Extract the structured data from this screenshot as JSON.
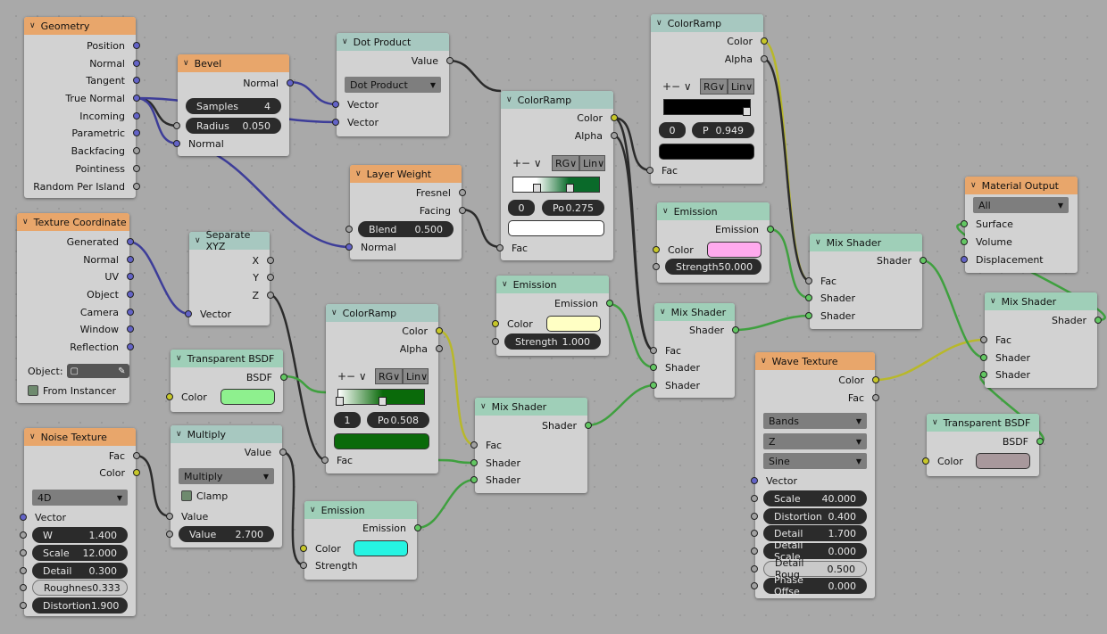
{
  "geometry": {
    "title": "Geometry",
    "outputs": [
      "Position",
      "Normal",
      "Tangent",
      "True Normal",
      "Incoming",
      "Parametric",
      "Backfacing",
      "Pointiness",
      "Random Per Island"
    ]
  },
  "texcoord": {
    "title": "Texture Coordinate",
    "outputs": [
      "Generated",
      "Normal",
      "UV",
      "Object",
      "Camera",
      "Window",
      "Reflection"
    ],
    "object_label": "Object:",
    "from_instancer": "From Instancer"
  },
  "noise": {
    "title": "Noise Texture",
    "outputs": [
      "Fac",
      "Color"
    ],
    "dimension": "4D",
    "vector": "Vector",
    "fields": [
      {
        "label": "W",
        "value": "1.400"
      },
      {
        "label": "Scale",
        "value": "12.000"
      },
      {
        "label": "Detail",
        "value": "0.300"
      },
      {
        "label": "Roughnes",
        "value": "0.333"
      },
      {
        "label": "Distortion",
        "value": "1.900"
      }
    ]
  },
  "bevel": {
    "title": "Bevel",
    "output": "Normal",
    "samples_label": "Samples",
    "samples_value": "4",
    "radius_label": "Radius",
    "radius_value": "0.050",
    "normal": "Normal"
  },
  "separate": {
    "title": "Separate XYZ",
    "outputs": [
      "X",
      "Y",
      "Z"
    ],
    "input": "Vector"
  },
  "transparent1": {
    "title": "Transparent BSDF",
    "output": "BSDF",
    "color_label": "Color",
    "color": "#8ef08e"
  },
  "multiply": {
    "title": "Multiply",
    "output": "Value",
    "operation": "Multiply",
    "clamp": "Clamp",
    "input": "Value",
    "value_label": "Value",
    "value": "2.700"
  },
  "dot": {
    "title": "Dot Product",
    "output": "Value",
    "operation": "Dot Product",
    "inputs": [
      "Vector",
      "Vector"
    ]
  },
  "layerweight": {
    "title": "Layer Weight",
    "outputs": [
      "Fresnel",
      "Facing"
    ],
    "blend_label": "Blend",
    "blend_value": "0.500",
    "normal": "Normal"
  },
  "colorramp1": {
    "title": "ColorRamp",
    "outputs": [
      "Color",
      "Alpha"
    ],
    "tools": "+− ∨",
    "mode": "RG∨",
    "interp": "Lin∨",
    "index": "0",
    "pos_label": "Po",
    "pos": "0.275",
    "fac": "Fac",
    "swatch": "#ffffff"
  },
  "colorramp2": {
    "title": "ColorRamp",
    "outputs": [
      "Color",
      "Alpha"
    ],
    "tools": "+− ∨",
    "mode": "RG∨",
    "interp": "Lin∨",
    "index": "1",
    "pos_label": "Po",
    "pos": "0.508",
    "fac": "Fac",
    "swatch": "#0a6a0a"
  },
  "colorramp3": {
    "title": "ColorRamp",
    "outputs": [
      "Color",
      "Alpha"
    ],
    "tools": "+− ∨",
    "mode": "RG∨",
    "interp": "Lin∨",
    "index": "0",
    "pos_label": "P",
    "pos": "0.949",
    "fac": "Fac",
    "swatch": "#000000"
  },
  "emission1": {
    "title": "Emission",
    "output": "Emission",
    "color_label": "Color",
    "color": "#ffffc4",
    "strength_label": "Strength",
    "strength": "1.000"
  },
  "emission2": {
    "title": "Emission",
    "output": "Emission",
    "color_label": "Color",
    "color": "#26f4e2",
    "strength_label": "Strength"
  },
  "emission3": {
    "title": "Emission",
    "output": "Emission",
    "color_label": "Color",
    "color": "#ffaaee",
    "strength_label": "Strength",
    "strength": "50.000"
  },
  "mix1": {
    "title": "Mix Shader",
    "output": "Shader",
    "inputs": [
      "Fac",
      "Shader",
      "Shader"
    ]
  },
  "mix2": {
    "title": "Mix Shader",
    "output": "Shader",
    "inputs": [
      "Fac",
      "Shader",
      "Shader"
    ]
  },
  "mix3": {
    "title": "Mix Shader",
    "output": "Shader",
    "inputs": [
      "Fac",
      "Shader",
      "Shader"
    ]
  },
  "mix4": {
    "title": "Mix Shader",
    "output": "Shader",
    "inputs": [
      "Fac",
      "Shader",
      "Shader"
    ]
  },
  "wave": {
    "title": "Wave Texture",
    "outputs": [
      "Color",
      "Fac"
    ],
    "type": "Bands",
    "axis": "Z",
    "profile": "Sine",
    "vector": "Vector",
    "fields": [
      {
        "label": "Scale",
        "value": "40.000"
      },
      {
        "label": "Distortion",
        "value": "0.400"
      },
      {
        "label": "Detail",
        "value": "1.700"
      },
      {
        "label": "Detail Scale",
        "value": "0.000"
      },
      {
        "label": "Detail Roug",
        "value": "0.500"
      },
      {
        "label": "Phase Offse",
        "value": "0.000"
      }
    ]
  },
  "transparent2": {
    "title": "Transparent BSDF",
    "output": "BSDF",
    "color_label": "Color",
    "color": "#a8989c"
  },
  "output": {
    "title": "Material Output",
    "target": "All",
    "inputs": [
      "Surface",
      "Volume",
      "Displacement"
    ]
  },
  "colors": {
    "wire_gray": "#2b2b2b",
    "wire_blue": "#3d3d99",
    "wire_green": "#3fa03f",
    "wire_yellow": "#b8b82a"
  }
}
